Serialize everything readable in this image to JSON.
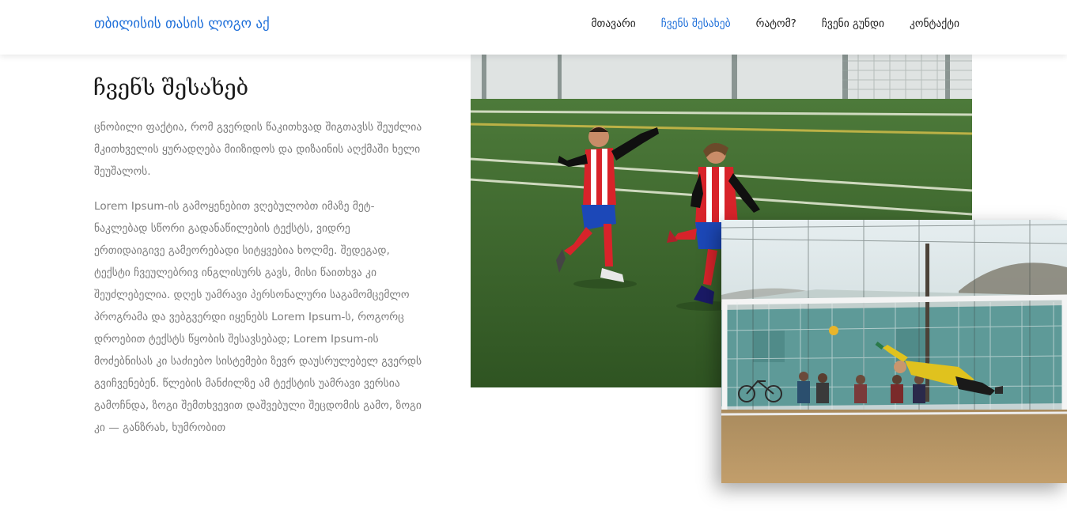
{
  "header": {
    "logo_text": "თბილისის თასის ლოგო აქ",
    "nav": [
      {
        "label": "მთავარი"
      },
      {
        "label": "ჩვენს შესახებ"
      },
      {
        "label": "რატომ?"
      },
      {
        "label": "ჩვენი გუნდი"
      },
      {
        "label": "კონტაქტი"
      }
    ],
    "active_color": "#1e6fd9"
  },
  "about": {
    "title": "ჩვენს შესახებ",
    "paragraph1": "ცნობილი ფაქტია, რომ გვერდის წაკითხვად შიგთავსს შეუძლია მკითხველის ყურადღება მიიზიდოს და დიზაინის აღქმაში ხელი შეუშალოს.",
    "paragraph2": "Lorem Ipsum-ის გამოყენებით ვღებულობთ იმაზე მეტ-ნაკლებად სწორი გადანაწილების ტექსტს, ვიდრე ერთიდაიგივე გამეორებადი სიტყვებია ხოლმე. შედეგად, ტექსტი ჩვეულებრივ ინგლისურს გავს, მისი წაითხვა კი შეუძლებელია. დღეს უამრავი პერსონალური საგამომცემლო პროგრამა და ვებგვერდი იყენებს Lorem Ipsum-ს, როგორც დროებით ტექსტს წყობის შესავსებად; Lorem Ipsum-ის მოძებნისას კი საძიებო სისტემები ზევრ დაუსრულებელ გვერდს გვიჩვენებენ. წლების მანძილზე ამ ტექსტის უამრავი ვერსია გამოჩნდა, ზოგი შემთხვევით დაშვებული შეცდომის გამო, ზოგი კი — განზრახ, ხუმრობით"
  },
  "images": {
    "photo1": "kids-celebrating-football-photo",
    "photo2": "goalkeeper-diving-photo"
  }
}
